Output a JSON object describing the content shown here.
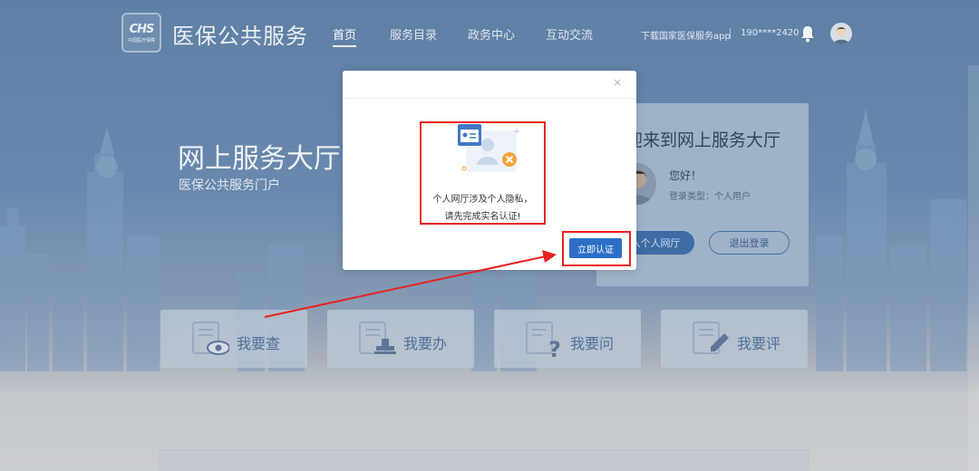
{
  "header": {
    "logo_mark": "CHS",
    "logo_sub": "中国医疗保障",
    "site_title": "医保公共服务",
    "nav": [
      {
        "label": "首页",
        "active": true
      },
      {
        "label": "服务目录",
        "active": false
      },
      {
        "label": "政务中心",
        "active": false
      },
      {
        "label": "互动交流",
        "active": false
      }
    ],
    "download_link": "下载国家医保服务app",
    "phone": "190****2420"
  },
  "hero": {
    "title": "网上服务大厅",
    "subtitle": "医保公共服务门户"
  },
  "welcome_card": {
    "title": "迎来到网上服务大厅",
    "greeting": "您好！",
    "login_type": "登录类型：个人用户",
    "enter_button": "入个人网厅",
    "logout_button": "退出登录"
  },
  "services": [
    {
      "label": "我要查",
      "icon": "doc-eye-icon"
    },
    {
      "label": "我要办",
      "icon": "doc-stamp-icon"
    },
    {
      "label": "我要问",
      "icon": "doc-question-icon"
    },
    {
      "label": "我要评",
      "icon": "doc-pen-icon"
    }
  ],
  "modal": {
    "close": "×",
    "message_line1": "个人网厅涉及个人隐私，",
    "message_line2": "请先完成实名认证!",
    "verify_button": "立即认证"
  },
  "colors": {
    "accent": "#2d6fc7",
    "annotation_red": "#e8231f",
    "header_bg": "#5f7fa5"
  }
}
